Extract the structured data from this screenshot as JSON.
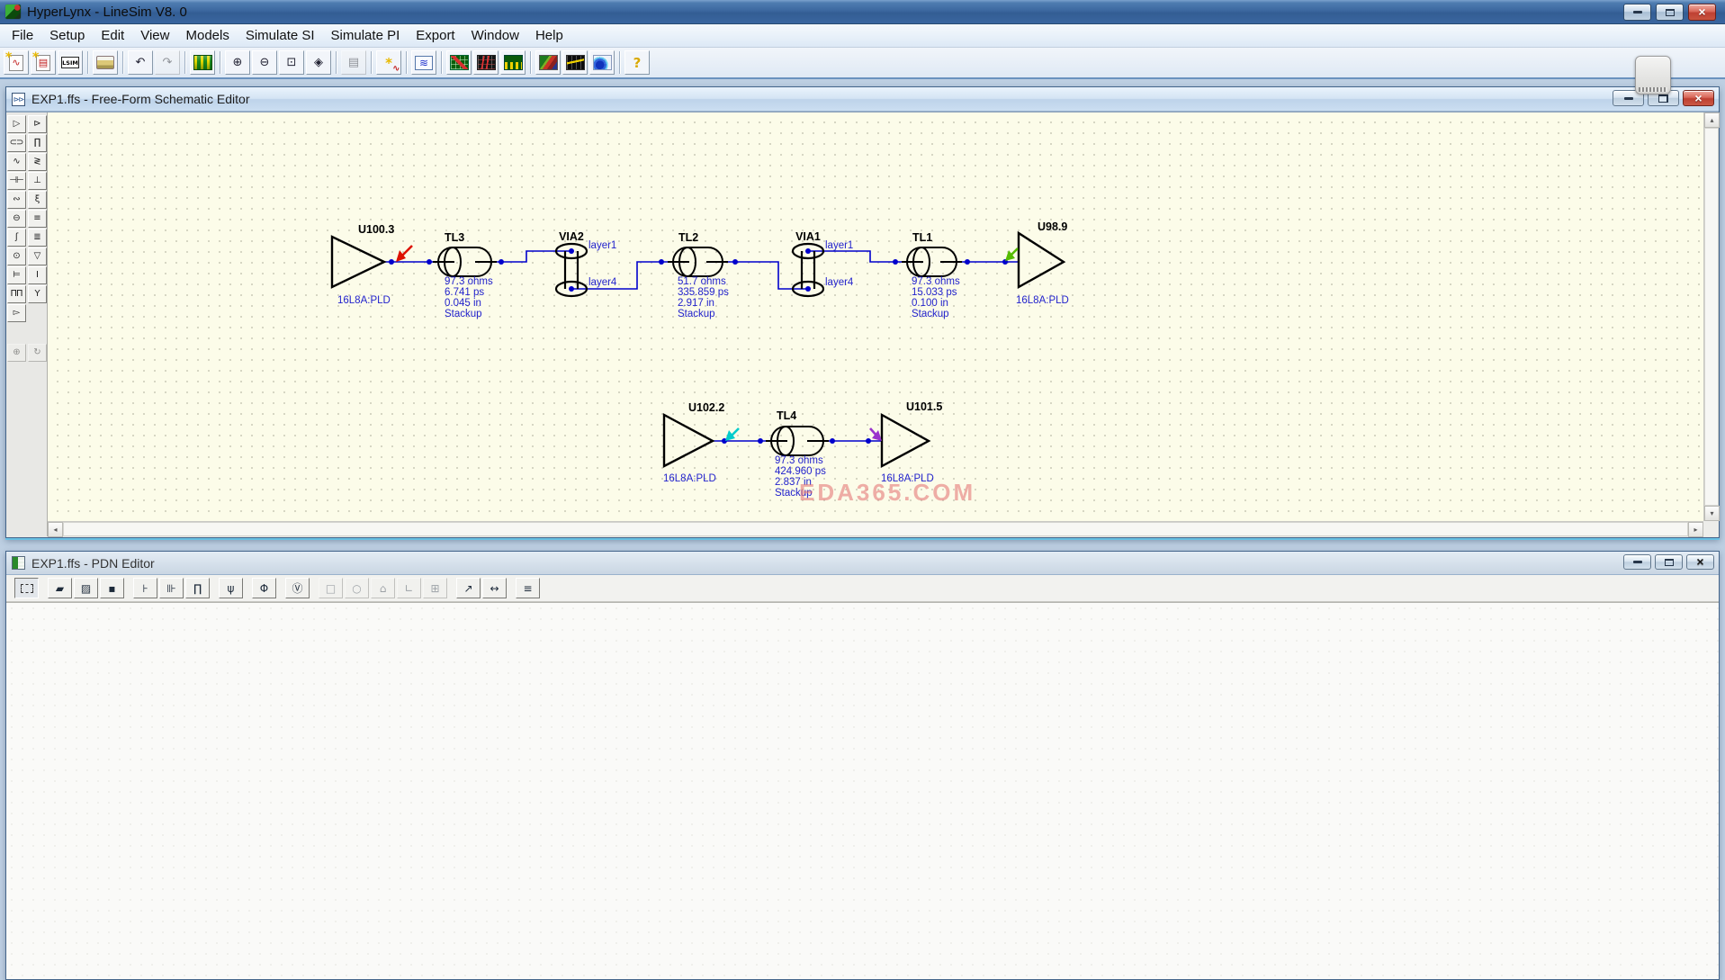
{
  "app": {
    "title": "HyperLynx - LineSim V8. 0",
    "icon": "hyperlynx-logo-icon"
  },
  "menu_items": [
    "File",
    "Setup",
    "Edit",
    "View",
    "Models",
    "Simulate SI",
    "Simulate PI",
    "Export",
    "Window",
    "Help"
  ],
  "main_toolbar": [
    {
      "name": "new-schematic-button",
      "icon": "new-schematic-icon",
      "glyph": "∿",
      "cls": "i-doc spark"
    },
    {
      "name": "open-schematic-button",
      "icon": "open-schematic-icon",
      "glyph": "▤",
      "cls": "i-doc spark"
    },
    {
      "name": "lsim-button",
      "icon": "lsim-icon",
      "glyph": "LSIM",
      "cls": "i-lsim"
    },
    {
      "name": "print-button",
      "icon": "printer-icon",
      "cls": "i-print",
      "sepBefore": true
    },
    {
      "name": "undo-button",
      "icon": "undo-arrow-icon",
      "glyph": "↶",
      "cls": "i-glyph",
      "sepBefore": true
    },
    {
      "name": "redo-button",
      "icon": "redo-arrow-icon",
      "glyph": "↷",
      "cls": "i-glyph",
      "disabled": true
    },
    {
      "name": "stackup-editor-button",
      "icon": "stackup-icon",
      "cls": "i-stackup",
      "sepBefore": true
    },
    {
      "name": "zoom-in-button",
      "icon": "zoom-in-icon",
      "glyph": "⊕",
      "cls": "i-glyph",
      "sepBefore": true
    },
    {
      "name": "zoom-out-button",
      "icon": "zoom-out-icon",
      "glyph": "⊖",
      "cls": "i-glyph"
    },
    {
      "name": "zoom-area-button",
      "icon": "zoom-area-icon",
      "glyph": "⊡",
      "cls": "i-glyph"
    },
    {
      "name": "zoom-fit-button",
      "icon": "zoom-fit-icon",
      "glyph": "◈",
      "cls": "i-glyph"
    },
    {
      "name": "report-button",
      "icon": "report-icon",
      "glyph": "▤",
      "cls": "i-glyph",
      "disabled": true,
      "sepBefore": true
    },
    {
      "name": "wizard-button",
      "icon": "wizard-wand-icon",
      "glyph": "*",
      "cls": "i-wand",
      "sepBefore": true
    },
    {
      "name": "oscilloscope-button",
      "icon": "oscilloscope-icon",
      "glyph": "≋",
      "cls": "i-osc",
      "sepBefore": true
    },
    {
      "name": "eye-mask-button",
      "icon": "eye-mask-icon",
      "cls": "i-eyemask",
      "sepBefore": true
    },
    {
      "name": "eye-diagram-button",
      "icon": "eye-diagram-icon",
      "cls": "i-eyered"
    },
    {
      "name": "ber-chart-button",
      "icon": "bar-chart-icon",
      "cls": "i-bars"
    },
    {
      "name": "plane-noise-button",
      "icon": "plane-noise-map-icon",
      "cls": "i-map",
      "sepBefore": true
    },
    {
      "name": "spectrum-button",
      "icon": "spectrum-icon",
      "cls": "i-spectrum"
    },
    {
      "name": "viewer-3d-button",
      "icon": "3d-viewer-icon",
      "cls": "i-3d"
    },
    {
      "name": "help-button",
      "icon": "help-icon",
      "glyph": "?",
      "cls": "i-help",
      "sepBefore": true
    }
  ],
  "schematic_editor": {
    "title": "EXP1.ffs - Free-Form Schematic Editor",
    "palette_tools": [
      {
        "name": "driver-tool",
        "icon": "driver-buffer-icon",
        "glyph": "▷"
      },
      {
        "name": "ibis-buffer-tool",
        "icon": "ibis-buffer-icon",
        "glyph": "⊳"
      },
      {
        "name": "tline-tool",
        "icon": "transmission-line-icon",
        "glyph": "⊂⊃"
      },
      {
        "name": "via-tool",
        "icon": "via-icon",
        "glyph": "∏"
      },
      {
        "name": "resistor-tool",
        "icon": "resistor-icon",
        "glyph": "∿"
      },
      {
        "name": "pull-resistor-tool",
        "icon": "pull-resistor-icon",
        "glyph": "≷"
      },
      {
        "name": "capacitor-tool",
        "icon": "capacitor-icon",
        "glyph": "⊣⊢"
      },
      {
        "name": "capacitor-gnd-tool",
        "icon": "capacitor-ground-icon",
        "glyph": "⊥"
      },
      {
        "name": "inductor-tool",
        "icon": "inductor-icon",
        "glyph": "∾"
      },
      {
        "name": "coil-tool",
        "icon": "coil-icon",
        "glyph": "ξ"
      },
      {
        "name": "stub-tool",
        "icon": "stub-icon",
        "glyph": "⊖"
      },
      {
        "name": "ground-tool",
        "icon": "ground-icon",
        "glyph": "≡"
      },
      {
        "name": "ferrite-bead-tool",
        "icon": "ferrite-bead-icon",
        "glyph": "ʃ"
      },
      {
        "name": "ground-pair-tool",
        "icon": "ground-pair-icon",
        "glyph": "≣"
      },
      {
        "name": "source-tool",
        "icon": "voltage-source-icon",
        "glyph": "⊙"
      },
      {
        "name": "ground-arrow-tool",
        "icon": "ground-arrow-icon",
        "glyph": "▽"
      },
      {
        "name": "ic-tool",
        "icon": "ic-symbol-icon",
        "glyph": "⊨"
      },
      {
        "name": "spool-tool",
        "icon": "spool-icon",
        "glyph": "I"
      },
      {
        "name": "via-pair-tool",
        "icon": "via-pair-icon",
        "glyph": "ΠΠ"
      },
      {
        "name": "probe-tool",
        "icon": "probe-icon",
        "glyph": "Y"
      },
      {
        "name": "buffer-tool",
        "icon": "small-buffer-icon",
        "glyph": "▻"
      },
      {
        "blank": true
      },
      {
        "gap": true
      },
      {
        "name": "move-tool",
        "icon": "move-crosshair-icon",
        "glyph": "⊕",
        "disabled": true
      },
      {
        "name": "rotate-tool",
        "icon": "rotate-icon",
        "glyph": "↻",
        "disabled": true
      }
    ],
    "components": {
      "buffers": [
        {
          "ref": "U100.3",
          "model": "16L8A:PLD"
        },
        {
          "ref": "U98.9",
          "model": "16L8A:PLD"
        },
        {
          "ref": "U102.2",
          "model": "16L8A:PLD"
        },
        {
          "ref": "U101.5",
          "model": "16L8A:PLD"
        }
      ],
      "tlines": [
        {
          "ref": "TL3",
          "impedance": "97.3 ohms",
          "delay": "6.741 ps",
          "length": "0.045 in",
          "model": "Stackup"
        },
        {
          "ref": "TL2",
          "impedance": "51.7 ohms",
          "delay": "335.859 ps",
          "length": "2.917 in",
          "model": "Stackup"
        },
        {
          "ref": "TL1",
          "impedance": "97.3 ohms",
          "delay": "15.033 ps",
          "length": "0.100 in",
          "model": "Stackup"
        },
        {
          "ref": "TL4",
          "impedance": "97.3 ohms",
          "delay": "424.960 ps",
          "length": "2.837 in",
          "model": "Stackup"
        }
      ],
      "vias": [
        {
          "ref": "VIA2",
          "top_label": "layer1",
          "bottom_label": "layer4"
        },
        {
          "ref": "VIA1",
          "top_label": "layer1",
          "bottom_label": "layer4"
        }
      ]
    },
    "watermark": "EDA365.COM"
  },
  "pdn_editor": {
    "title": "EXP1.ffs - PDN Editor",
    "toolbar": [
      {
        "name": "select-marquee-button",
        "icon": "selection-marquee-icon",
        "cls": "pdn-marquee",
        "pressed": true
      },
      {
        "name": "plane-shape-button",
        "icon": "plane-shape-icon",
        "glyph": "▰",
        "gapBefore": true
      },
      {
        "name": "plane-cutout-button",
        "icon": "plane-cutout-icon",
        "glyph": "▨"
      },
      {
        "name": "pad-button",
        "icon": "pad-icon",
        "glyph": "▪"
      },
      {
        "name": "decap-button",
        "icon": "decap-icon",
        "glyph": "⊦",
        "gapBefore": true
      },
      {
        "name": "decap-pair-button",
        "icon": "decap-pair-icon",
        "glyph": "⊪"
      },
      {
        "name": "via-array-button",
        "icon": "via-array-icon",
        "glyph": "∏"
      },
      {
        "name": "pin-button",
        "icon": "pin-icon",
        "glyph": "ψ",
        "gapBefore": true
      },
      {
        "name": "port-button",
        "icon": "port-icon",
        "glyph": "Φ",
        "gapBefore": true
      },
      {
        "name": "vrm-button",
        "icon": "vrm-icon",
        "glyph": "Ⓥ",
        "gapBefore": true
      },
      {
        "name": "rectangle-button",
        "icon": "rectangle-icon",
        "glyph": "□",
        "disabled": true,
        "gapBefore": true
      },
      {
        "name": "ellipse-button",
        "icon": "ellipse-icon",
        "glyph": "○",
        "disabled": true
      },
      {
        "name": "polygon-button",
        "icon": "polygon-icon",
        "glyph": "⌂",
        "disabled": true
      },
      {
        "name": "route-button",
        "icon": "route-segment-icon",
        "glyph": "∟",
        "disabled": true
      },
      {
        "name": "copy-shape-button",
        "icon": "copy-shape-icon",
        "glyph": "⊞",
        "disabled": true
      },
      {
        "name": "probe-arrow-button",
        "icon": "probe-arrow-icon",
        "glyph": "↗",
        "gapBefore": true
      },
      {
        "name": "measure-button",
        "icon": "measure-icon",
        "glyph": "↔"
      },
      {
        "name": "stackup-view-button",
        "icon": "stackup-layers-icon",
        "glyph": "≡",
        "gapBefore": true
      }
    ]
  },
  "colors": {
    "canvas": "#FCFCE9",
    "wire": "#0000CC",
    "param_text": "#2222CC",
    "probe_red": "#DD1100",
    "probe_green": "#55BB00",
    "probe_cyan": "#00CCCC",
    "probe_purple": "#9933CC"
  }
}
